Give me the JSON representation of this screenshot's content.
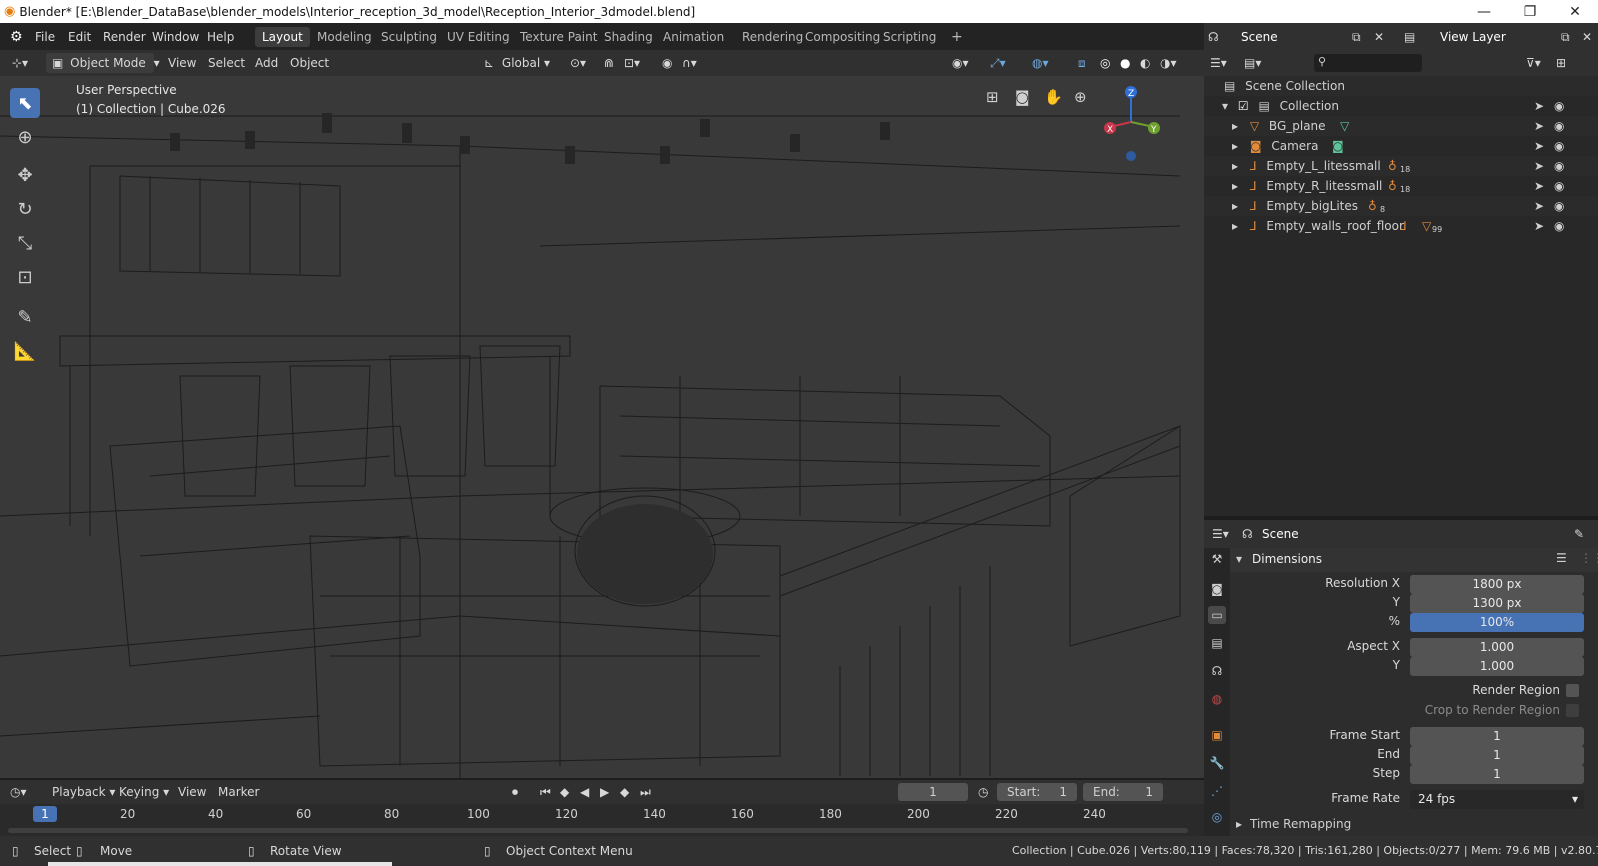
{
  "window": {
    "title": "Blender* [E:\\Blender_DataBase\\blender_models\\Interior_reception_3d_model\\Reception_Interior_3dmodel.blend]",
    "min": "—",
    "restore": "❐",
    "close": "✕"
  },
  "menu": {
    "items": [
      "File",
      "Edit",
      "Render",
      "Window",
      "Help"
    ],
    "workspaces": [
      "Layout",
      "Modeling",
      "Sculpting",
      "UV Editing",
      "Texture Paint",
      "Shading",
      "Animation",
      "Rendering",
      "Compositing",
      "Scripting"
    ],
    "add_tab": "+",
    "active_workspace": "Layout"
  },
  "viewport": {
    "mode": "Object Mode",
    "menus": [
      "View",
      "Select",
      "Add",
      "Object"
    ],
    "orientation": "Global",
    "overlay_title": "User Perspective",
    "overlay_sub": "(1) Collection | Cube.026",
    "gizmo": {
      "x": "X",
      "y": "Y",
      "z": "Z"
    }
  },
  "outliner": {
    "header_scene": "Scene",
    "view_layer": "View Layer",
    "root": "Scene Collection",
    "collection": "Collection",
    "objects": [
      {
        "name": "BG_plane",
        "badge": ""
      },
      {
        "name": "Camera",
        "badge": ""
      },
      {
        "name": "Empty_L_litessmall",
        "badge": "18"
      },
      {
        "name": "Empty_R_litessmall",
        "badge": "18"
      },
      {
        "name": "Empty_bigLites",
        "badge": "8"
      },
      {
        "name": "Empty_walls_roof_floor",
        "badge": "99"
      }
    ]
  },
  "properties": {
    "context": "Scene",
    "panel": "Dimensions",
    "res_x_label": "Resolution X",
    "res_x": "1800 px",
    "res_y_label": "Y",
    "res_y": "1300 px",
    "pct_label": "%",
    "pct": "100%",
    "aspect_x_label": "Aspect X",
    "aspect_x": "1.000",
    "aspect_y_label": "Y",
    "aspect_y": "1.000",
    "render_region": "Render Region",
    "crop_region": "Crop to Render Region",
    "frame_start_label": "Frame Start",
    "frame_start": "1",
    "end_label": "End",
    "end": "1",
    "step_label": "Step",
    "step": "1",
    "frame_rate_label": "Frame Rate",
    "frame_rate": "24 fps",
    "time_remap": "Time Remapping"
  },
  "timeline": {
    "menus": [
      "Playback",
      "Keying",
      "View",
      "Marker"
    ],
    "current_frame": "1",
    "start_label": "Start:",
    "start": "1",
    "end_label": "End:",
    "end": "1",
    "ticks": [
      "1",
      "20",
      "40",
      "60",
      "80",
      "100",
      "120",
      "140",
      "160",
      "180",
      "200",
      "220",
      "240"
    ]
  },
  "status": {
    "select": "Select",
    "move": "Move",
    "rotate": "Rotate View",
    "context_menu": "Object Context Menu",
    "stats": "Collection | Cube.026 | Verts:80,119 | Faces:78,320 | Tris:161,280 | Objects:0/277 | Mem: 79.6 MB | v2.80.75"
  }
}
